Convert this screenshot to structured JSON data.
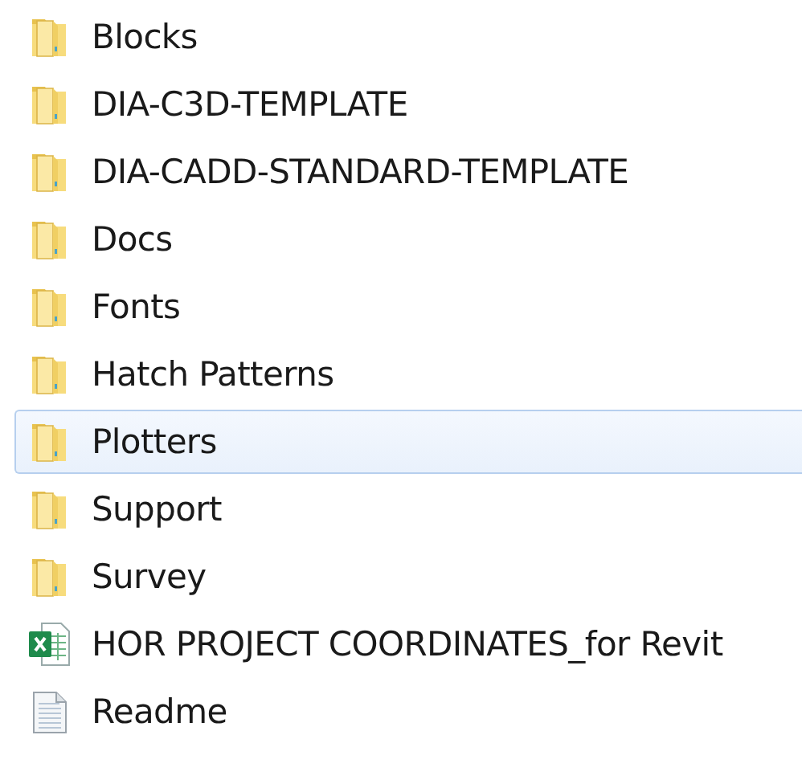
{
  "files": [
    {
      "name": "Blocks",
      "kind": "folder",
      "selected": false
    },
    {
      "name": "DIA-C3D-TEMPLATE",
      "kind": "folder",
      "selected": false
    },
    {
      "name": "DIA-CADD-STANDARD-TEMPLATE",
      "kind": "folder",
      "selected": false
    },
    {
      "name": "Docs",
      "kind": "folder",
      "selected": false
    },
    {
      "name": "Fonts",
      "kind": "folder",
      "selected": false
    },
    {
      "name": "Hatch Patterns",
      "kind": "folder",
      "selected": false
    },
    {
      "name": "Plotters",
      "kind": "folder",
      "selected": true
    },
    {
      "name": "Support",
      "kind": "folder",
      "selected": false
    },
    {
      "name": "Survey",
      "kind": "folder",
      "selected": false
    },
    {
      "name": "HOR PROJECT COORDINATES_for Revit",
      "kind": "spreadsheet",
      "selected": false
    },
    {
      "name": "Readme",
      "kind": "text",
      "selected": false
    }
  ]
}
